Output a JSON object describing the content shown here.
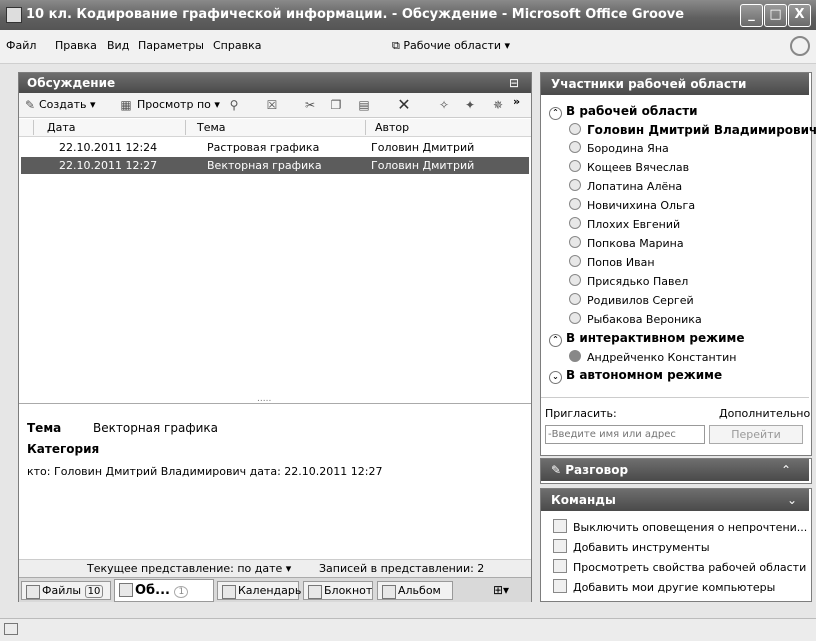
{
  "window": {
    "title": "10 кл. Кодирование графической информации. - Обсуждение - Microsoft Office Groove",
    "minimize": "_",
    "maximize": "□",
    "close": "X"
  },
  "menu": {
    "items": [
      "Файл",
      "Правка",
      "Вид",
      "Параметры",
      "Справка"
    ],
    "workspaces": "Рабочие области ▾"
  },
  "discussion": {
    "title": "Обсуждение",
    "toolbar": {
      "create": "Создать ▾",
      "view": "Просмотр по ▾",
      "more": "»"
    },
    "columns": [
      "Дата",
      "Тема",
      "Автор"
    ],
    "rows": [
      {
        "date": "22.10.2011 12:24",
        "topic": "Растровая графика",
        "author": "Головин Дмитрий"
      },
      {
        "date": "22.10.2011 12:27",
        "topic": "Векторная графика",
        "author": "Головин Дмитрий"
      }
    ],
    "splitter_grip": ".....",
    "preview": {
      "topic_label": "Тема",
      "topic_value": "Векторная графика",
      "category_label": "Категория",
      "meta": "кто: Головин Дмитрий Владимирович дата: 22.10.2011 12:27"
    },
    "status": {
      "current_view": "Текущее представление: по дате ▾",
      "records": "Записей в представлении: 2"
    },
    "tabs": [
      {
        "label": "Файлы",
        "badge": "10"
      },
      {
        "label": "Об...",
        "badge": "1"
      },
      {
        "label": "Календарь"
      },
      {
        "label": "Блокнот"
      },
      {
        "label": "Альбом"
      }
    ]
  },
  "members": {
    "title": "Участники рабочей области",
    "groups": {
      "in_workspace": "В рабочей области",
      "online": "В интерактивном режиме",
      "offline": "В автономном режиме"
    },
    "in_workspace": [
      "Головин Дмитрий Владимирович",
      "Бородина Яна",
      "Кощеев Вячеслав",
      "Лопатина Алёна",
      "Новичихина Ольга",
      "Плохих Евгений",
      "Попкова Марина",
      "Попов Иван",
      "Присядько Павел",
      "Родивилов Сергей",
      "Рыбакова Вероника"
    ],
    "online": [
      "Андрейченко Константин"
    ],
    "invite_label": "Пригласить:",
    "more_label": "Дополнительно",
    "invite_placeholder": "-Введите имя или адрес",
    "go_button": "Перейти"
  },
  "chat": {
    "title": "Разговор"
  },
  "commands": {
    "title": "Команды",
    "items": [
      "Выключить оповещения о непрочтени...",
      "Добавить инструменты",
      "Просмотреть свойства рабочей области",
      "Добавить мои другие компьютеры"
    ]
  }
}
